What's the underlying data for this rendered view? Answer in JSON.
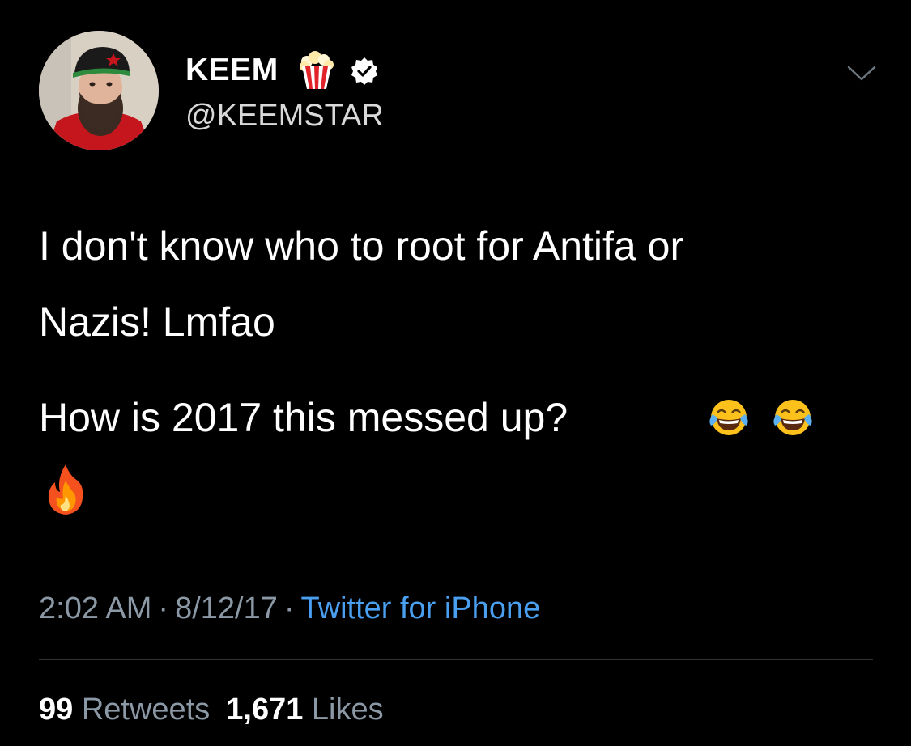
{
  "author": {
    "display_name": "KEEM",
    "handle": "@KEEMSTAR",
    "name_emoji": "popcorn-icon",
    "verified": true
  },
  "tweet": {
    "line1": "I don't know who to root for Antifa or",
    "line2": "Nazis! Lmfao",
    "line3": "How is 2017 this messed up?",
    "trailing_emojis": [
      "face-with-tears-of-joy-icon",
      "face-with-tears-of-joy-icon",
      "fire-icon"
    ]
  },
  "meta": {
    "time": "2:02 AM",
    "separator": "·",
    "date": "8/12/17",
    "source": "Twitter for iPhone"
  },
  "stats": {
    "retweets_count": "99",
    "retweets_label": "Retweets",
    "likes_count": "1,671",
    "likes_label": "Likes"
  },
  "colors": {
    "background": "#000000",
    "text_primary": "#ffffff",
    "text_secondary": "#8b98a5",
    "link": "#4a9ff0",
    "divider": "#2f3336"
  }
}
